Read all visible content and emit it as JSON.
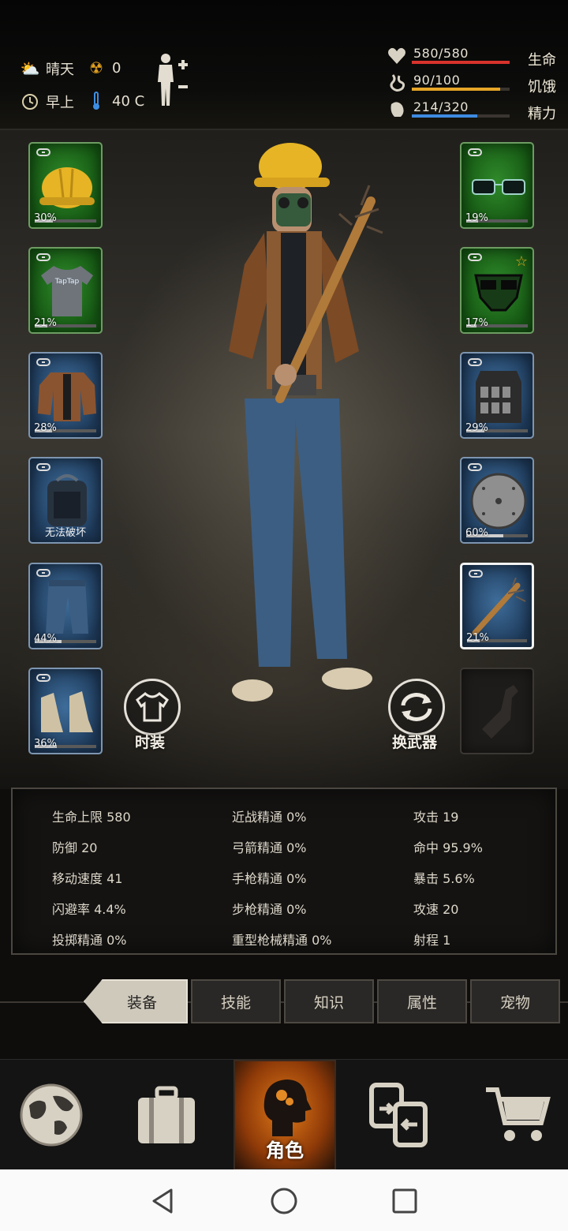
{
  "weather": {
    "condition": "晴天",
    "radiation": "0",
    "time_of_day": "早上",
    "temperature": "40 C"
  },
  "vitals": [
    {
      "value": "580/580",
      "label": "生命",
      "fraction": 1.0,
      "color": "#d8322c"
    },
    {
      "value": "90/100",
      "label": "饥饿",
      "fraction": 0.9,
      "color": "#e6a628"
    },
    {
      "value": "214/320",
      "label": "精力",
      "fraction": 0.67,
      "color": "#3e8be0"
    }
  ],
  "left_slots": [
    {
      "name": "helmet",
      "type": "green",
      "durability": "30%",
      "fraction": 0.3
    },
    {
      "name": "tshirt",
      "type": "green",
      "durability": "21%",
      "fraction": 0.21,
      "shirt_text": "TapTap"
    },
    {
      "name": "jacket",
      "type": "blue",
      "durability": "28%",
      "fraction": 0.28
    },
    {
      "name": "backpack",
      "type": "blue",
      "note": "无法破坏"
    },
    {
      "name": "jeans",
      "type": "blue",
      "durability": "44%",
      "fraction": 0.44
    },
    {
      "name": "boots",
      "type": "blue",
      "durability": "36%",
      "fraction": 0.36
    }
  ],
  "right_slots": [
    {
      "name": "glasses",
      "type": "green",
      "durability": "19%",
      "fraction": 0.19
    },
    {
      "name": "gas-mask",
      "type": "green",
      "durability": "17%",
      "fraction": 0.17,
      "star": "☆"
    },
    {
      "name": "vest",
      "type": "blue",
      "durability": "29%",
      "fraction": 0.29
    },
    {
      "name": "shield",
      "type": "blue",
      "durability": "60%",
      "fraction": 0.6
    },
    {
      "name": "spiked-bat",
      "type": "blue",
      "durability": "21%",
      "fraction": 0.21
    },
    {
      "name": "empty-bottle-slot",
      "type": "empty"
    }
  ],
  "actions": {
    "fashion": "时装",
    "swap_weapon": "换武器"
  },
  "stats": [
    [
      "生命上限 580",
      "近战精通 0%",
      "攻击 19"
    ],
    [
      "防御 20",
      "弓箭精通 0%",
      "命中 95.9%"
    ],
    [
      "移动速度 41",
      "手枪精通 0%",
      "暴击 5.6%"
    ],
    [
      "闪避率 4.4%",
      "步枪精通 0%",
      "攻速 20"
    ],
    [
      "投掷精通 0%",
      "重型枪械精通 0%",
      "射程 1"
    ]
  ],
  "tabs": [
    "装备",
    "技能",
    "知识",
    "属性",
    "宠物"
  ],
  "nav": {
    "items": [
      "globe-icon",
      "suitcase-icon",
      "character-icon",
      "trade-icon",
      "cart-icon"
    ],
    "active_label": "角色"
  }
}
